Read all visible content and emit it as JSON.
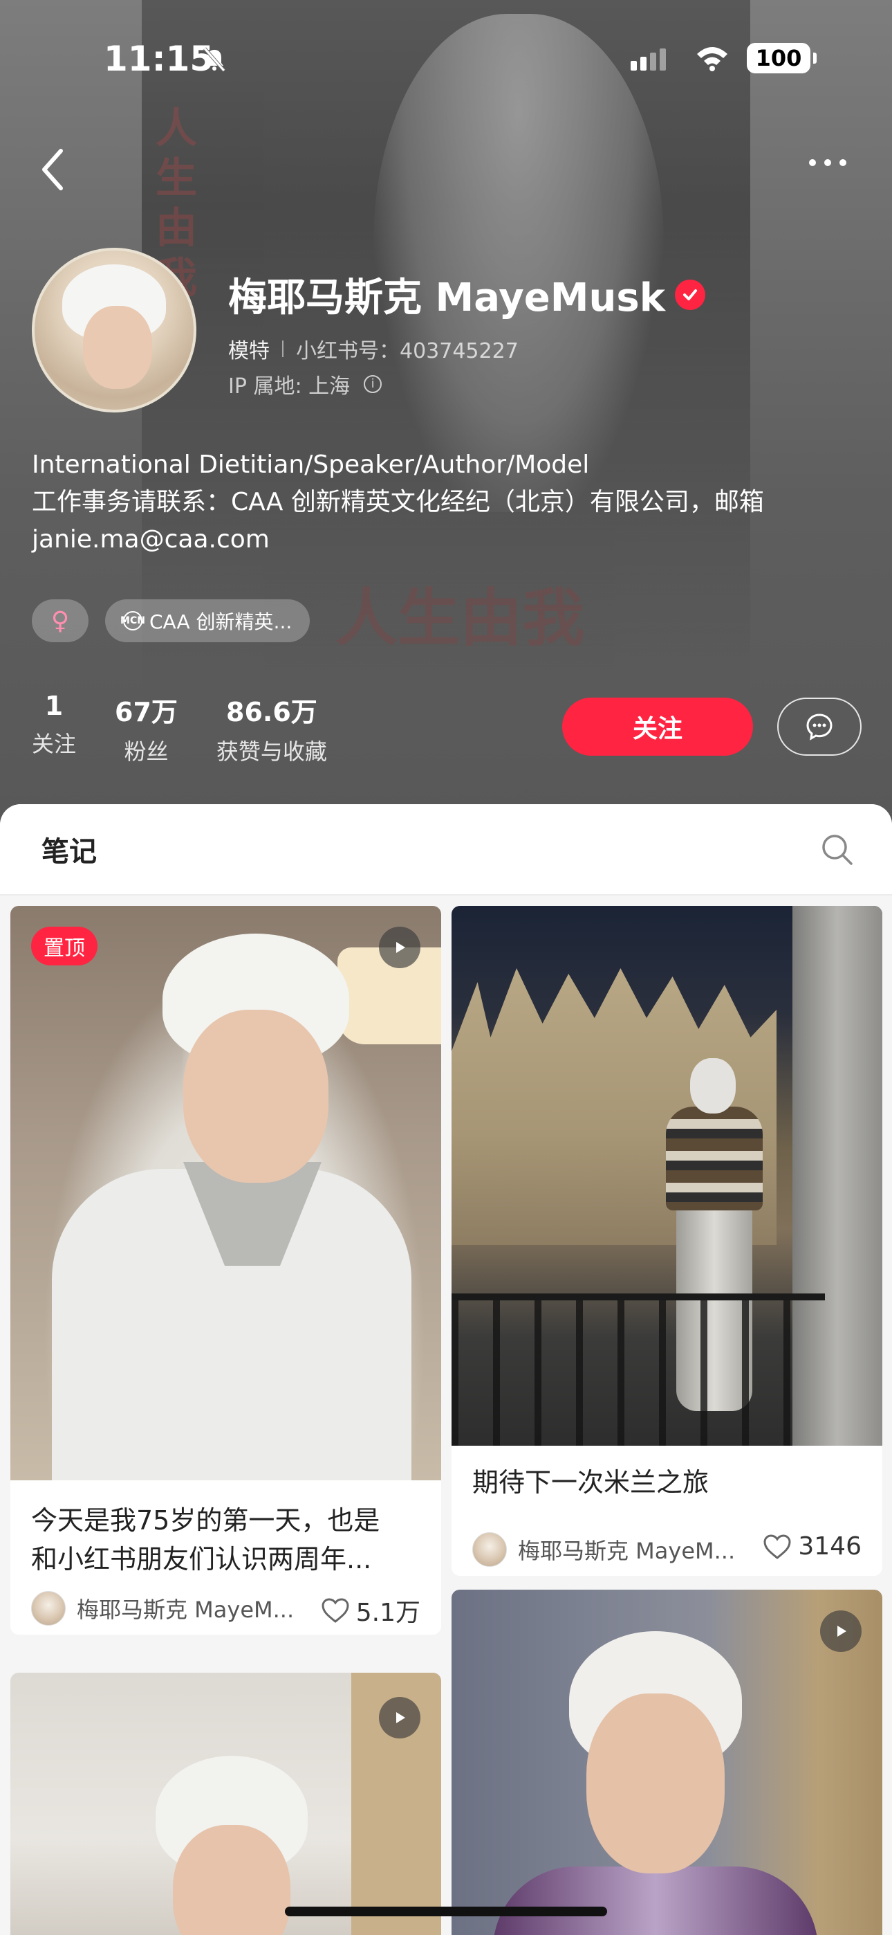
{
  "status_bar": {
    "time": "11:15",
    "battery": "100"
  },
  "profile": {
    "name": "梅耶马斯克 MayeMusk",
    "occupation": "模特",
    "redbook_id": "小红书号：403745227",
    "ip_location": "IP 属地: 上海",
    "bio_lines": [
      "International Dietitian/Speaker/Author/Model",
      "工作事务请联系：CAA 创新精英文化经纪（北京）有限公司，邮箱",
      "janie.ma@caa.com"
    ],
    "tags": {
      "gender_symbol": "♀",
      "mcn_badge": "MCN",
      "mcn_label": "CAA 创新精英..."
    },
    "stats": [
      {
        "value": "1",
        "label": "关注"
      },
      {
        "value": "67万",
        "label": "粉丝"
      },
      {
        "value": "86.6万",
        "label": "获赞与收藏"
      }
    ],
    "follow_label": "关注"
  },
  "tabs": {
    "notes_label": "笔记"
  },
  "notes": [
    {
      "pinned_label": "置顶",
      "title_lines": [
        "今天是我75岁的第一天，也是",
        "和小红书朋友们认识两周年..."
      ],
      "author": "梅耶马斯克 MayeM...",
      "likes": "5.1万",
      "is_video": true
    },
    {
      "title_lines": [
        "期待下一次米兰之旅"
      ],
      "author": "梅耶马斯克 MayeM...",
      "likes": "3146",
      "is_video": false
    },
    {
      "is_video": true
    },
    {
      "is_video": true
    }
  ],
  "background_book": {
    "title": "人生由我",
    "side_text": "人生由我"
  },
  "colors": {
    "accent": "#ff2442",
    "header_bg": "#6a6a6a",
    "page_bg": "#f5f5f5"
  }
}
